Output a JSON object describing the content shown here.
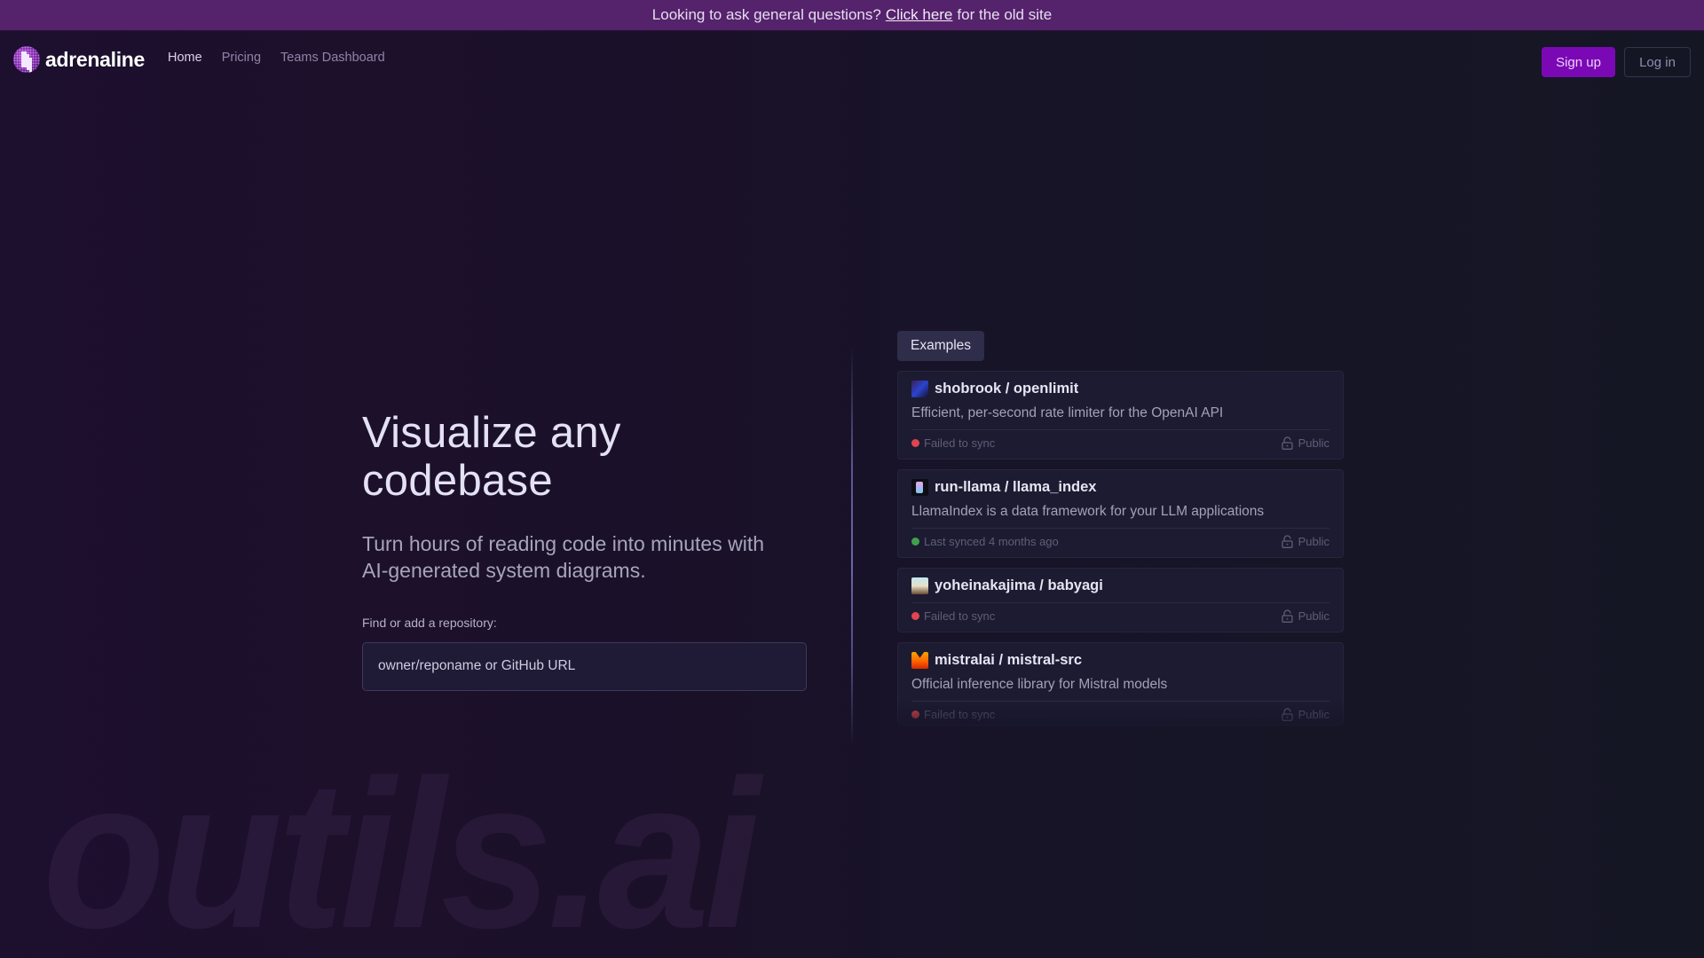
{
  "banner": {
    "prefix": "Looking to ask general questions?",
    "link": "Click here",
    "suffix": "for the old site"
  },
  "nav": {
    "logo_text": "adrenaline",
    "links": [
      {
        "label": "Home",
        "active": true
      },
      {
        "label": "Pricing",
        "active": false
      },
      {
        "label": "Teams Dashboard",
        "active": false
      }
    ],
    "signup_label": "Sign up",
    "login_label": "Log in"
  },
  "hero": {
    "title": "Visualize any codebase",
    "subtitle": "Turn hours of reading code into minutes with AI-generated system diagrams.",
    "input_label": "Find or add a repository:",
    "input_placeholder": "owner/reponame or GitHub URL",
    "input_value": ""
  },
  "examples": {
    "tab_label": "Examples",
    "repos": [
      {
        "name": "shobrook / openlimit",
        "description": "Efficient, per-second rate limiter for the OpenAI API",
        "status": "Failed to sync",
        "status_color": "#e0454f",
        "visibility": "Public"
      },
      {
        "name": "run-llama / llama_index",
        "description": "LlamaIndex is a data framework for your LLM applications",
        "status": "Last synced 4 months ago",
        "status_color": "#3fa24a",
        "visibility": "Public"
      },
      {
        "name": "yoheinakajima / babyagi",
        "description": "",
        "status": "Failed to sync",
        "status_color": "#e0454f",
        "visibility": "Public"
      },
      {
        "name": "mistralai / mistral-src",
        "description": "Official inference library for Mistral models",
        "status": "Failed to sync",
        "status_color": "#e0454f",
        "visibility": "Public"
      }
    ]
  },
  "watermark": "outils.ai",
  "colors": {
    "banner_bg": "#55226c",
    "signup_bg": "#7a09b5",
    "page_bg": "#1b1029"
  }
}
